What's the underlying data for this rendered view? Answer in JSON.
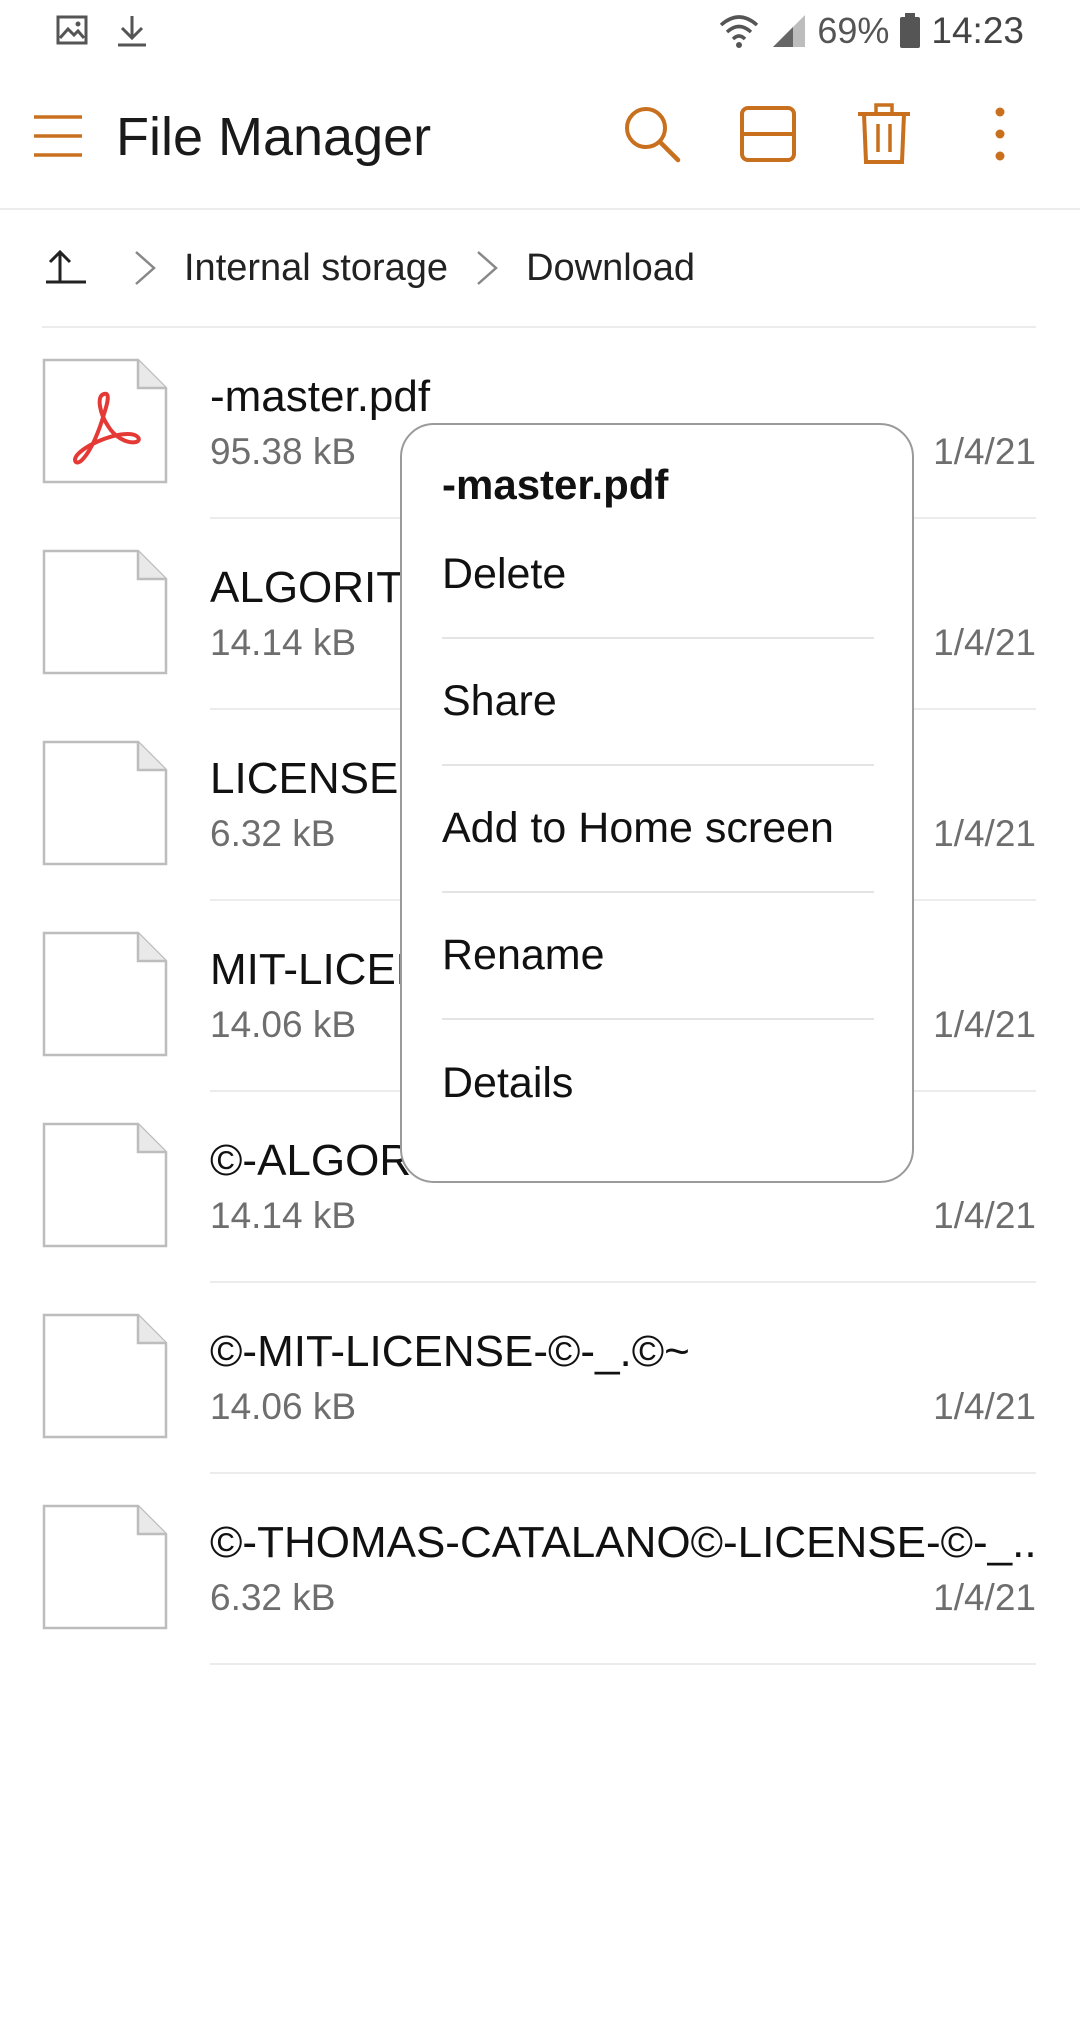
{
  "status_bar": {
    "left_icons": [
      "image-notification-icon",
      "download-notification-icon"
    ],
    "battery_percent": "69%",
    "time": "14:23"
  },
  "app_bar": {
    "title": "File Manager",
    "accent_color": "#c8701e",
    "actions": [
      "search-icon",
      "view-layout-icon",
      "delete-icon",
      "more-options-icon"
    ]
  },
  "breadcrumb": {
    "items": [
      "Internal storage",
      "Download"
    ]
  },
  "files": [
    {
      "name": "-master.pdf",
      "size": "95.38 kB",
      "date": "1/4/21",
      "type": "pdf"
    },
    {
      "name": "ALGORITHMS-LICENSE",
      "size": "14.14 kB",
      "date": "1/4/21",
      "type": "generic"
    },
    {
      "name": "LICENSE",
      "size": "6.32 kB",
      "date": "1/4/21",
      "type": "generic"
    },
    {
      "name": "MIT-LICENSE",
      "size": "14.06 kB",
      "date": "1/4/21",
      "type": "generic"
    },
    {
      "name": "©-ALGORITHMS",
      "size": "14.14 kB",
      "date": "1/4/21",
      "type": "generic"
    },
    {
      "name": "©-MIT-LICENSE-©-_.©~",
      "size": "14.06 kB",
      "date": "1/4/21",
      "type": "generic"
    },
    {
      "name": "©-THOMAS-CATALANO©-LICENSE-©-_..",
      "size": "6.32 kB",
      "date": "1/4/21",
      "type": "generic"
    }
  ],
  "context_menu": {
    "title": "-master.pdf",
    "items": [
      "Delete",
      "Share",
      "Add to Home screen",
      "Rename",
      "Details"
    ]
  }
}
